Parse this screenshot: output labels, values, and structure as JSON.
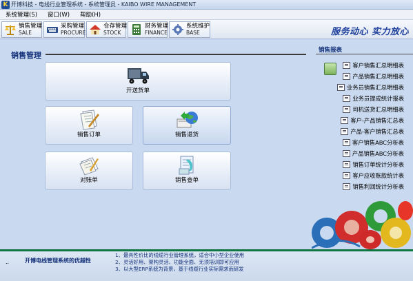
{
  "window": {
    "title": "开博科技 - 电线行业管理系统 - 系统管理员 - KAIBO WIRE MANAGEMENT",
    "icon_letter": "K"
  },
  "menu": [
    {
      "label": "系统管理(S)"
    },
    {
      "label": "窗口(W)"
    },
    {
      "label": "帮助(H)"
    }
  ],
  "toolbar": {
    "buttons": [
      {
        "cn": "销售管理",
        "en": "SALE",
        "icon": "scale-icon"
      },
      {
        "cn": "采购管理",
        "en": "PROCURE",
        "icon": "keyboard-icon"
      },
      {
        "cn": "仓存管理",
        "en": "STOCK",
        "icon": "house-icon"
      },
      {
        "cn": "财务管理",
        "en": "FINANCE",
        "icon": "calculator-icon"
      },
      {
        "cn": "系统维护",
        "en": "BASE",
        "icon": "gear-icon"
      }
    ],
    "slogan": "服务动心 实力放心"
  },
  "main": {
    "section_title": "销售管理",
    "buttons": [
      {
        "label": "开送货单",
        "icon": "truck-icon"
      },
      {
        "label": "销售订单",
        "icon": "document-pen-icon"
      },
      {
        "label": "销售退货",
        "icon": "globe-arrow-icon"
      },
      {
        "label": "对账单",
        "icon": "papers-pen-icon"
      },
      {
        "label": "销售查单",
        "icon": "search-document-icon"
      }
    ]
  },
  "reports": {
    "title": "销售报表",
    "items": [
      {
        "label": "客户销售汇总明细表"
      },
      {
        "label": "产品销售汇总明细表"
      },
      {
        "label": "业务员销售汇总明细表"
      },
      {
        "label": "业务员提成统计报表"
      },
      {
        "label": "司机送货汇总明细表"
      },
      {
        "label": "客户-产品销售汇总表"
      },
      {
        "label": "产品-客户销售汇总表"
      },
      {
        "label": "客户销售ABC分析表"
      },
      {
        "label": "产品销售ABC分析表"
      },
      {
        "label": "销售订单统计分析表"
      },
      {
        "label": "客户应收账款统计表"
      },
      {
        "label": "销售利润统计分析表"
      }
    ]
  },
  "footer": {
    "dots": "..",
    "advantages_title": "开博电线管理系统的优越性",
    "lines": [
      "1、最具性价比的线缆行业管理系统，适合中小型企业使用",
      "2、灵活好用、架构灵活、功能全面、无须培训即可应用",
      "3、以大型ERP系统为背景，基于线缆行业实际需求而研发"
    ]
  },
  "colors": {
    "background": "#c9d9ef",
    "heading": "#13307a",
    "slogan": "#1e3f9c",
    "footer_rule": "#0c7a40"
  }
}
